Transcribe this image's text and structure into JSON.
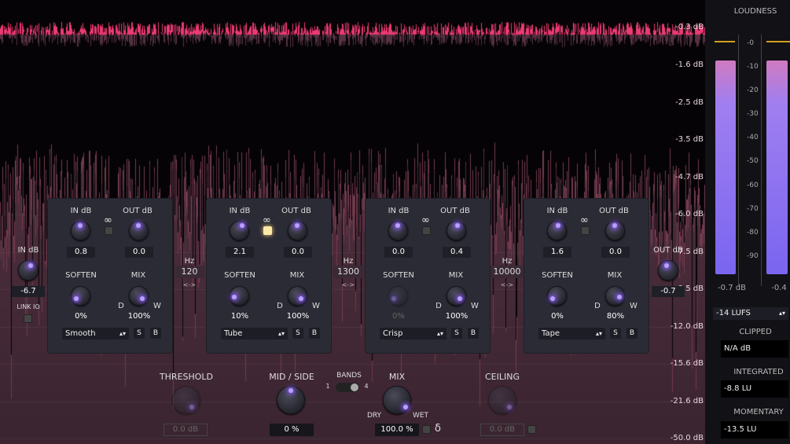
{
  "colors": {
    "top_band": "#ec3a73",
    "bg": "#4a2a38",
    "panel": "#2b2b35",
    "accent": "#8a5cff"
  },
  "scale": [
    "-0.3 dB",
    "-1.6 dB",
    "-2.5 dB",
    "-3.5 dB",
    "-4.7 dB",
    "-6.0 dB",
    "-7.5 dB",
    "-9.5 dB",
    "-12.0 dB",
    "-15.6 dB",
    "-21.6 dB",
    "-50.0 dB"
  ],
  "input": {
    "label": "IN dB",
    "value": "-6.7",
    "link_label": "LINK IO"
  },
  "output": {
    "label": "OUT dB",
    "value": "-0.7"
  },
  "bands": [
    {
      "in_label": "IN dB",
      "out_label": "OUT dB",
      "in": "0.8",
      "out": "0.0",
      "soften_label": "SOFTEN",
      "mix_label": "MIX",
      "soften": "0%",
      "mix": "100%",
      "mode": "Smooth",
      "s": "S",
      "b": "B",
      "dry": "D",
      "wet": "W",
      "inf": "∞"
    },
    {
      "in_label": "IN dB",
      "out_label": "OUT dB",
      "in": "2.1",
      "out": "0.0",
      "soften_label": "SOFTEN",
      "mix_label": "MIX",
      "soften": "10%",
      "mix": "100%",
      "mode": "Tube",
      "s": "S",
      "b": "B",
      "dry": "D",
      "wet": "W",
      "inf": "∞"
    },
    {
      "in_label": "IN dB",
      "out_label": "OUT dB",
      "in": "0.0",
      "out": "0.4",
      "soften_label": "SOFTEN",
      "mix_label": "MIX",
      "soften": "0%",
      "mix": "100%",
      "mode": "Crisp",
      "s": "S",
      "b": "B",
      "dry": "D",
      "wet": "W",
      "inf": "∞"
    },
    {
      "in_label": "IN dB",
      "out_label": "OUT dB",
      "in": "1.6",
      "out": "0.0",
      "soften_label": "SOFTEN",
      "mix_label": "MIX",
      "soften": "0%",
      "mix": "80%",
      "mode": "Tape",
      "s": "S",
      "b": "B",
      "dry": "D",
      "wet": "W",
      "inf": "∞"
    }
  ],
  "crossovers": [
    {
      "hz": "Hz",
      "freq": "120",
      "arrows": "<->"
    },
    {
      "hz": "Hz",
      "freq": "1300",
      "arrows": "<->"
    },
    {
      "hz": "Hz",
      "freq": "10000",
      "arrows": "<->"
    }
  ],
  "bottom": {
    "threshold_label": "THRESHOLD",
    "threshold": "0.0 dB",
    "midside_label": "MID / SIDE",
    "midside": "0 %",
    "bands_label": "BANDS",
    "bands_min": "1",
    "bands_max": "4",
    "mix_label": "MIX",
    "dry": "DRY",
    "wet": "WET",
    "mix": "100.0 %",
    "delta": "δ",
    "ceiling_label": "CEILING",
    "ceiling": "0.0 dB"
  },
  "loudness": {
    "title": "LOUDNESS",
    "scale": [
      "-0",
      "-10",
      "-20",
      "-30",
      "-40",
      "-50",
      "-60",
      "-70",
      "-80",
      "-90"
    ],
    "left_reading": "-0.7 dB",
    "right_reading": "-0.4",
    "target": "-14 LUFS",
    "clipped_label": "CLIPPED",
    "clipped": "N/A dB",
    "integrated_label": "INTEGRATED",
    "integrated": "-8.8 LU",
    "momentary_label": "MOMENTARY",
    "momentary": "-13.5 LU"
  }
}
